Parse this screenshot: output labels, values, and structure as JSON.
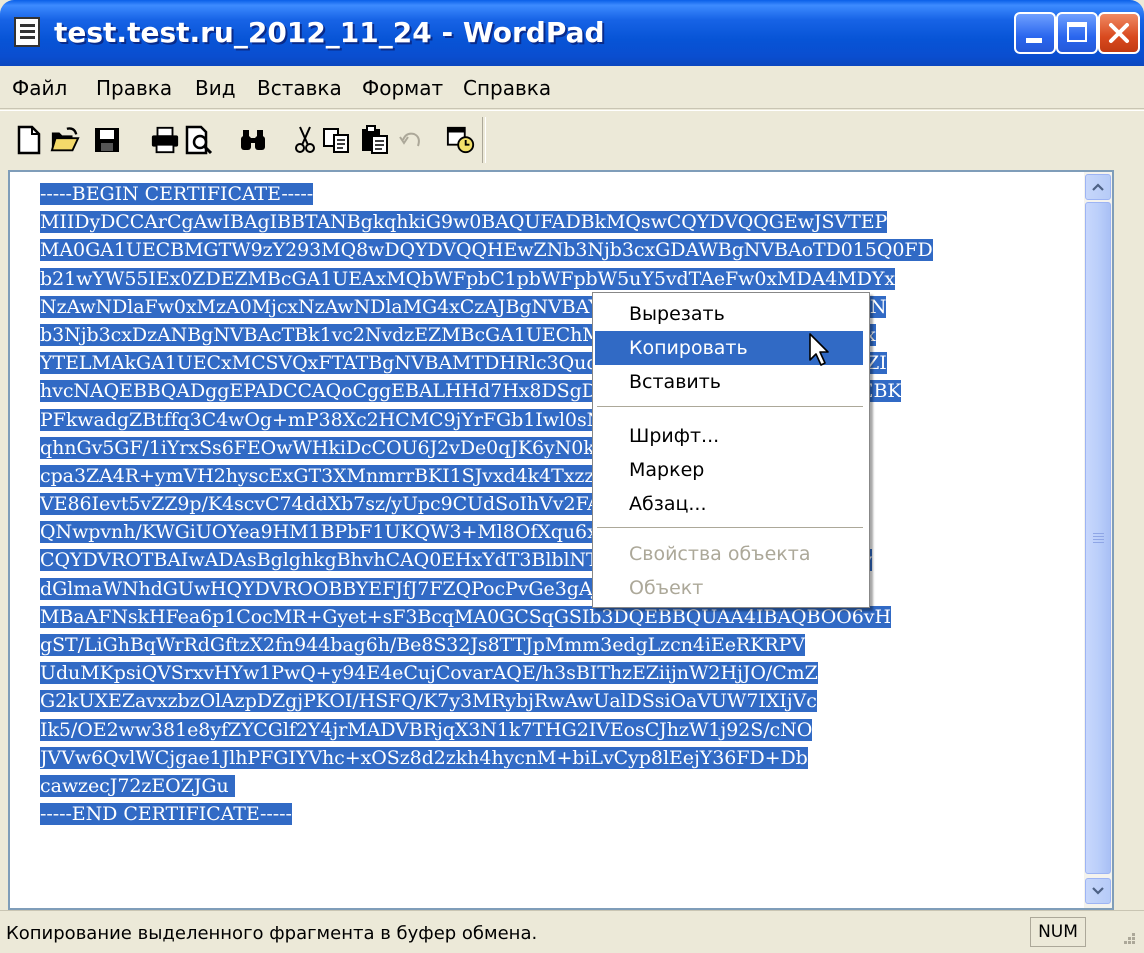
{
  "window": {
    "title": "test.test.ru_2012_11_24 - WordPad",
    "controls": [
      "minimize",
      "maximize",
      "close"
    ]
  },
  "menu": {
    "items": [
      "Файл",
      "Правка",
      "Вид",
      "Вставка",
      "Формат",
      "Справка"
    ]
  },
  "toolbar": {
    "icons": [
      "new-icon",
      "open-icon",
      "save-icon",
      "print-icon",
      "print-preview-icon",
      "find-icon",
      "cut-icon",
      "copy-icon",
      "paste-icon",
      "undo-icon",
      "insert-datetime-icon"
    ]
  },
  "document": {
    "lines": [
      "-----BEGIN CERTIFICATE-----",
      "MIIDyDCCArCgAwIBAgIBBTANBgkqhkiG9w0BAQUFADBkMQswCQYDVQQGEwJSVTEP",
      "MA0GA1UECBMGTW9zY293MQ8wDQYDVQQHEwZNb3Njb3cxGDAWBgNVBAoTD015Q0FD",
      "b21wYW55IEx0ZDEZMBcGA1UEAxMQbWFpbC1pbWFpbW5uY5vdTAeFw0xMDA4MDYx",
      "NzAwNDlaFw0xMzA0MjcxNzAwNDlaMG4xCzAJBgNVBAYTAlJVMQ8wDQYDVQQIEwZN",
      "b3Njb3cxDzANBgNVBAcTBk1vc2NvdzEZMBcGA1UEChMQTXkgQ29tcGFueSBMdGQx",
      "YTELMAkGA1UECxMCSVQxFTATBgNVBAMTDHRlc3QudGVzdC5ydTCCASIwDQYJKoZI",
      "hvcNAQEBBQADggEPADCCAQoCggEBALHHd7Hx8DSgDBcDQu6mX3uYU+1x7djyPIEBK",
      "PFkwadgZBtffq3C4wOg+mP38Xc2HCMC9jYrFGb1Iwl0sN2pQh6grXYoJ5ghZzYD",
      "qhnGv5GF/1iYrxSs6FEOwWHkiDcCOU6J2vDe0qJK6yN0kZ8eB1Bebx6D+LVqpR4",
      "cpa3ZA4R+ymVH2hyscExGT3XMnmrrBKI1SJvxd4k4TxzzRbOlfwmYogeOcBxOo",
      "VE86Ievt5vZZ9p/K4scvC74ddXb7sz/yUpc9CUdSoIhVv2FA3g/LXC/zzQlyGW",
      "QNwpvnh/KWGiUOYea9HM1BPbF1UKQW3+Ml8OfXqu6xYBN0ICAwEAAaN7MHkw",
      "CQYDVROTBAIwADAsBglghkgBhvhCAQ0EHxYdT3BlblNTTCBHZW5lcmF0ZWQgQ2Vy",
      "dGlmaWNhdGUwHQYDVROOBBYEFJfJ7FZQPocPvGe3gAJnfvUPJytfMB8GA1UdIwQY",
      "MBaAFNskHFea6p1CocMR+Gyet+sF3BcqMA0GCSqGSIb3DQEBBQUAA4IBAQBOO6vH",
      "gST/LiGhBqWrRdGftzX2fn944bag6h/Be8S32Js8TTJpMmm3edgLzcn4iEeRKRPV",
      "UduMKpsiQVSrxvHYw1PwQ+y94E4eCujCovarAQE/h3sBIThzEZiijnW2HjJO/CmZ",
      "G2kUXEZavxzbzOlAzpDZgjPKOI/HSFQ/K7y3MRybjRwAwUalDSsiOaVUW7IXIjVc",
      "Ik5/OE2ww381e8yfZYCGlf2Y4jrMADVBRjqX3N1k7THG2IVEosCJhzW1j92S/cNO",
      "JVVw6QvlWCjgae1JlhPFGIYVhc+xOSz8d2zkh4hycnM+biLvCyp8lEejY36FD+Db",
      "cawzecJ72zEOZJGu ",
      "-----END CERTIFICATE-----"
    ]
  },
  "context_menu": {
    "items": [
      {
        "label": "Вырезать",
        "state": "normal"
      },
      {
        "label": "Копировать",
        "state": "highlighted"
      },
      {
        "label": "Вставить",
        "state": "normal"
      },
      {
        "label": "Шрифт...",
        "state": "normal"
      },
      {
        "label": "Маркер",
        "state": "normal"
      },
      {
        "label": "Абзац...",
        "state": "normal"
      },
      {
        "label": "Свойства объекта",
        "state": "disabled"
      },
      {
        "label": "Объект",
        "state": "disabled"
      }
    ]
  },
  "status": {
    "text": "Копирование выделенного фрагмента в буфер обмена.",
    "num": "NUM"
  },
  "colors": {
    "selection": "#316AC5",
    "titlebar": "#0A5FE8",
    "face": "#ECE9D8"
  }
}
